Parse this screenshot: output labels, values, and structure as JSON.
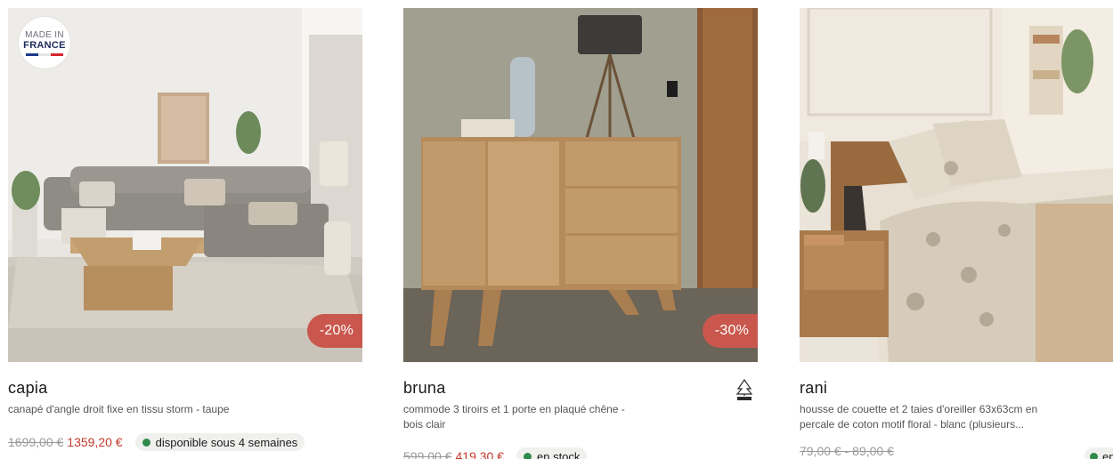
{
  "products": [
    {
      "name": "capia",
      "description": "canapé d'angle droit fixe en tissu storm - taupe",
      "old_price": "1699,00 €",
      "new_price": "1359,20 €",
      "availability": "disponible sous 4 semaines",
      "discount": "-20%",
      "badge": {
        "line1": "MADE IN",
        "line2": "FRANCE",
        "colors": [
          "#1d3a8a",
          "#ffffff",
          "#d8262e"
        ]
      }
    },
    {
      "name": "bruna",
      "description": "commode 3 tiroirs et 1 porte en plaqué chêne - bois clair",
      "old_price": "599,00 €",
      "new_price": "419,30 €",
      "availability": "en stock",
      "discount": "-30%",
      "certification_icon": "fsc-tree-icon"
    },
    {
      "name": "rani",
      "description": "housse de couette et 2 taies d'oreiller 63x63cm en percale de coton motif floral - blanc (plusieurs...",
      "price_range": "79,00 € - 89,00 €",
      "availability": "en"
    }
  ],
  "colors": {
    "discount_bg": "#c9574d",
    "sale_price": "#c23a2d",
    "in_stock_dot": "#2f8a4a"
  }
}
